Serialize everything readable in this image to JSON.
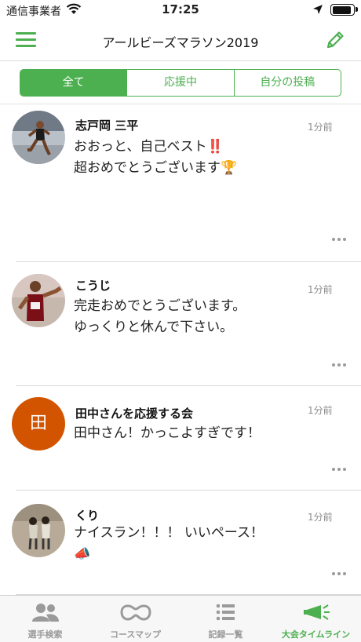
{
  "status_bar": {
    "carrier": "通信事業者",
    "time": "17:25",
    "battery_level": 0.9
  },
  "header": {
    "title": "アールビーズマラソン2019"
  },
  "segments": [
    {
      "label": "全て",
      "active": true
    },
    {
      "label": "応援中",
      "active": false
    },
    {
      "label": "自分の投稿",
      "active": false
    }
  ],
  "posts": [
    {
      "name": "志戸岡 三平",
      "time": "1分前",
      "message": "おおっと、自己ベスト‼️\n超おめでとうございます🏆",
      "avatar": "runner-photo"
    },
    {
      "name": "こうじ",
      "time": "1分前",
      "message": "完走おめでとうございます。\nゆっくりと休んで下さい。",
      "avatar": "runner-photo"
    },
    {
      "name": "田中さんを応援する会",
      "time": "1分前",
      "message": "田中さん！かっこよすぎです！",
      "avatar_initial": "田",
      "avatar_color": "#d35400"
    },
    {
      "name": "くり",
      "time": "1分前",
      "message": "ナイスラン！！！ いいペース！\n📣",
      "avatar": "couple-photo"
    }
  ],
  "tabbar": [
    {
      "label": "選手検索",
      "icon": "people-icon",
      "active": false
    },
    {
      "label": "コースマップ",
      "icon": "course-map-icon",
      "active": false
    },
    {
      "label": "記録一覧",
      "icon": "list-icon",
      "active": false
    },
    {
      "label": "大会タイムライン",
      "icon": "megaphone-icon",
      "active": true
    }
  ],
  "colors": {
    "accent": "#4caf50",
    "divider": "#d9d9d9",
    "avatar_initial_bg": "#d35400"
  }
}
